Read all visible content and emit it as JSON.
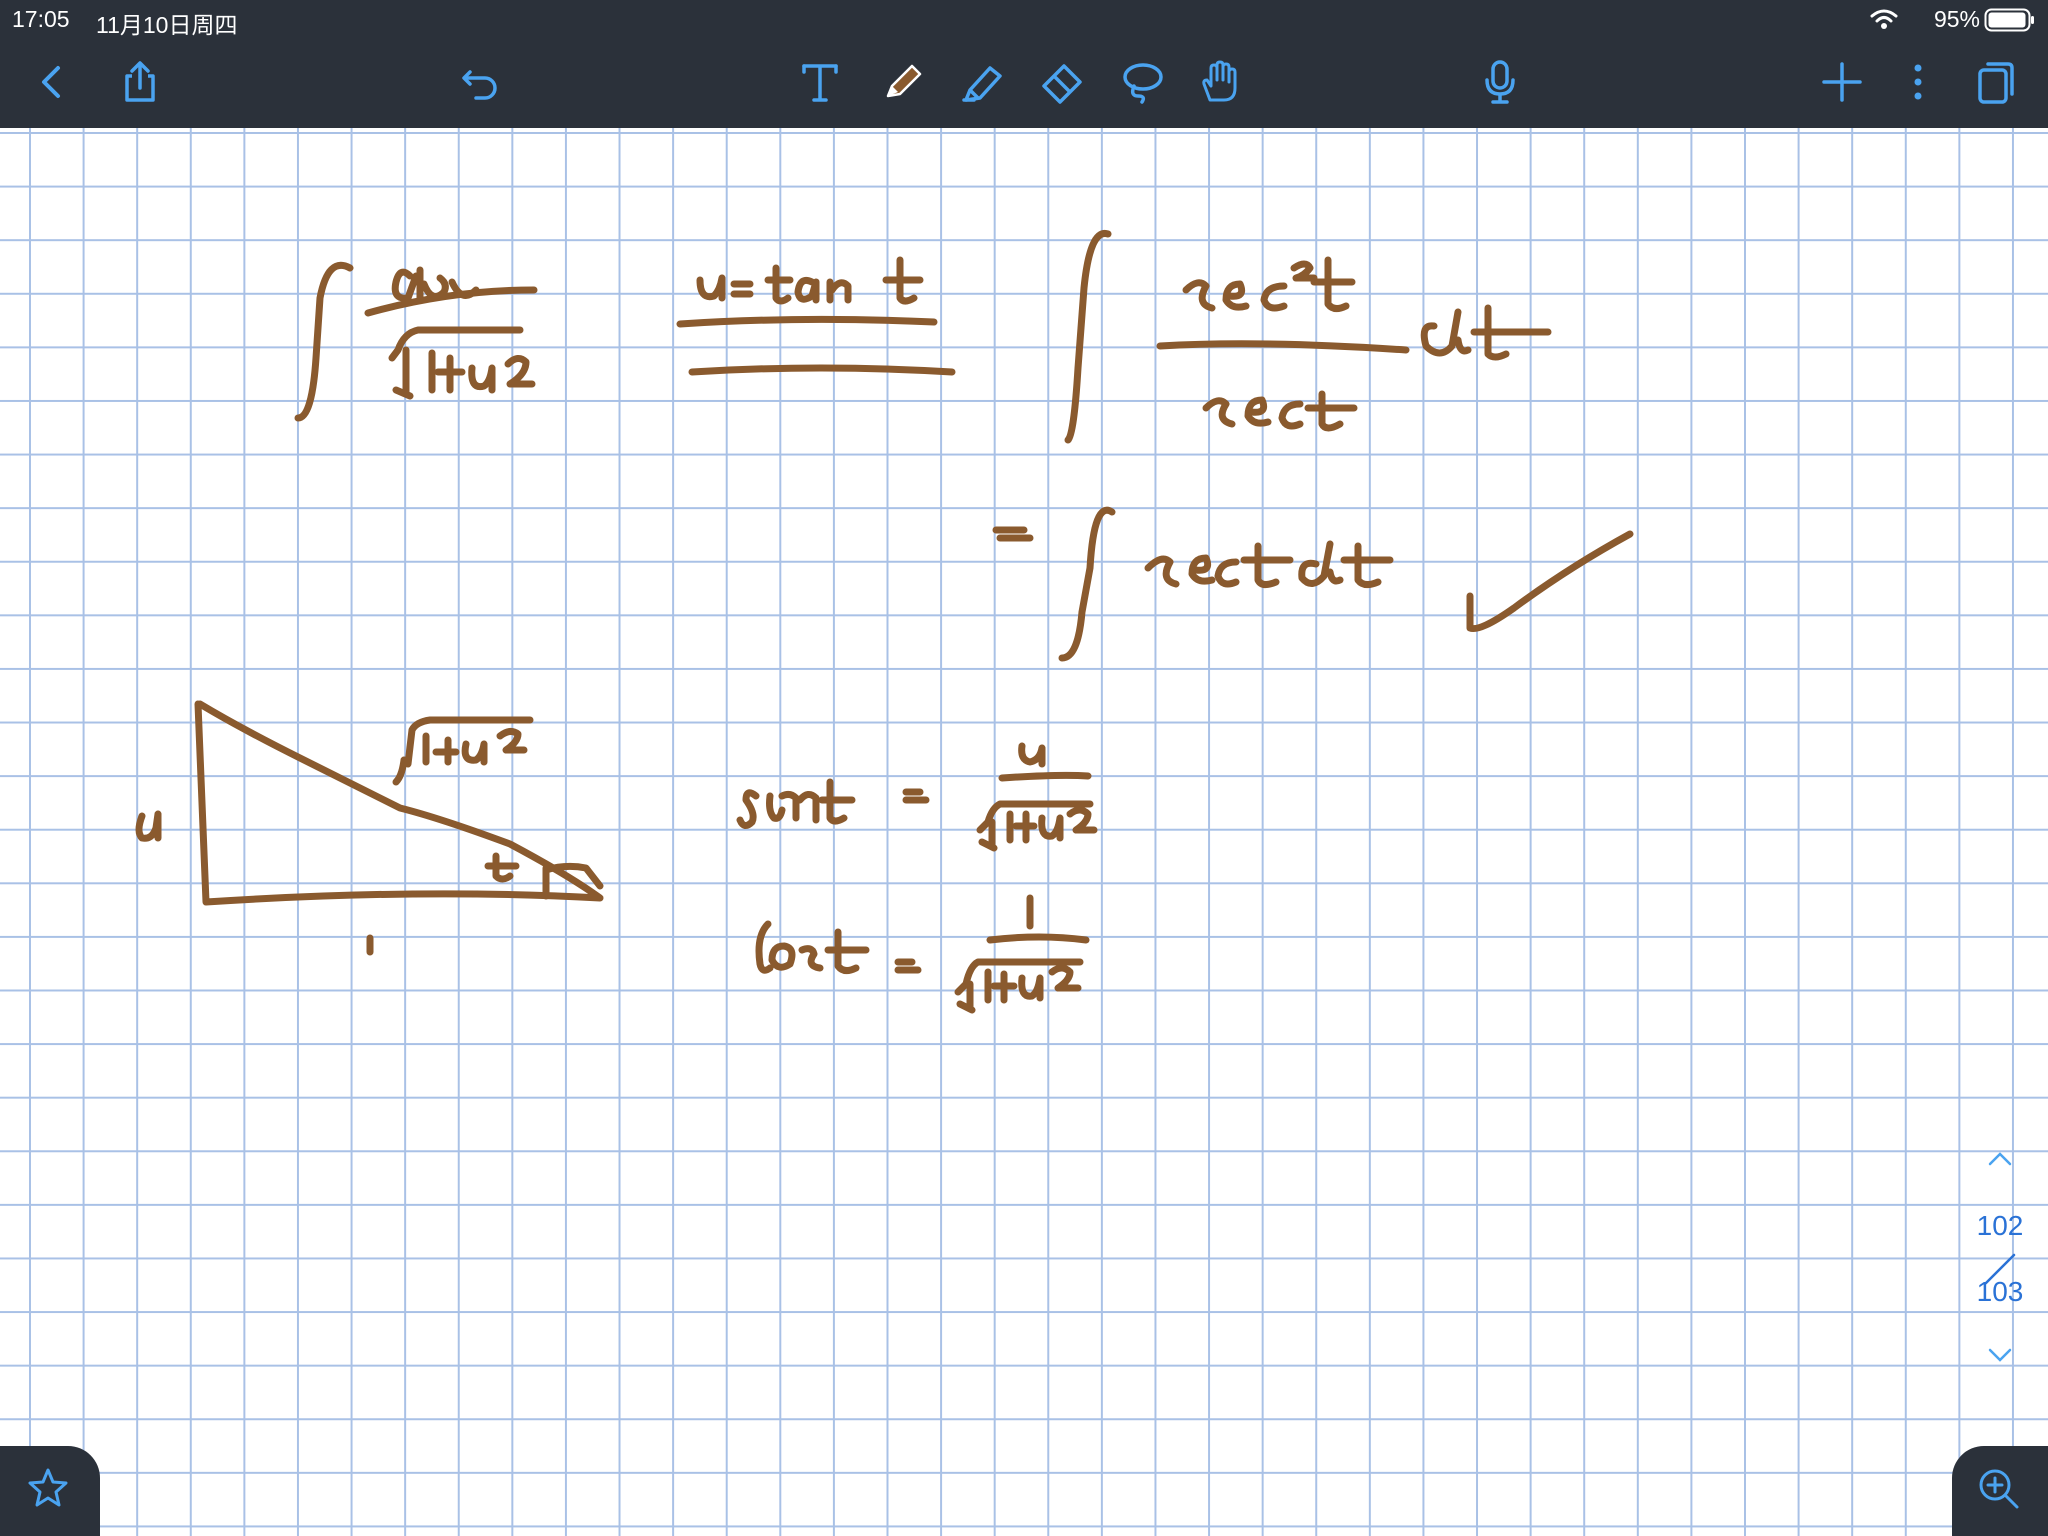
{
  "status_bar": {
    "time": "17:05",
    "date": "11月10日周四",
    "battery": "95%"
  },
  "toolbar": {
    "left": [
      "back-icon",
      "share-icon",
      "undo-icon"
    ],
    "tools": [
      "text-tool-icon",
      "pen-tool-icon",
      "highlighter-tool-icon",
      "eraser-tool-icon",
      "lasso-tool-icon",
      "hand-tool-icon"
    ],
    "right": [
      "microphone-icon",
      "add-icon",
      "more-icon",
      "pages-icon"
    ],
    "accent": "#4aa3f0"
  },
  "note": {
    "ink_color": "#8a5a2e",
    "grid_color": "#a9c1e6"
  },
  "pager": {
    "current": "102",
    "total": "103"
  },
  "corners": [
    "star-icon",
    "zoom-in-icon"
  ]
}
